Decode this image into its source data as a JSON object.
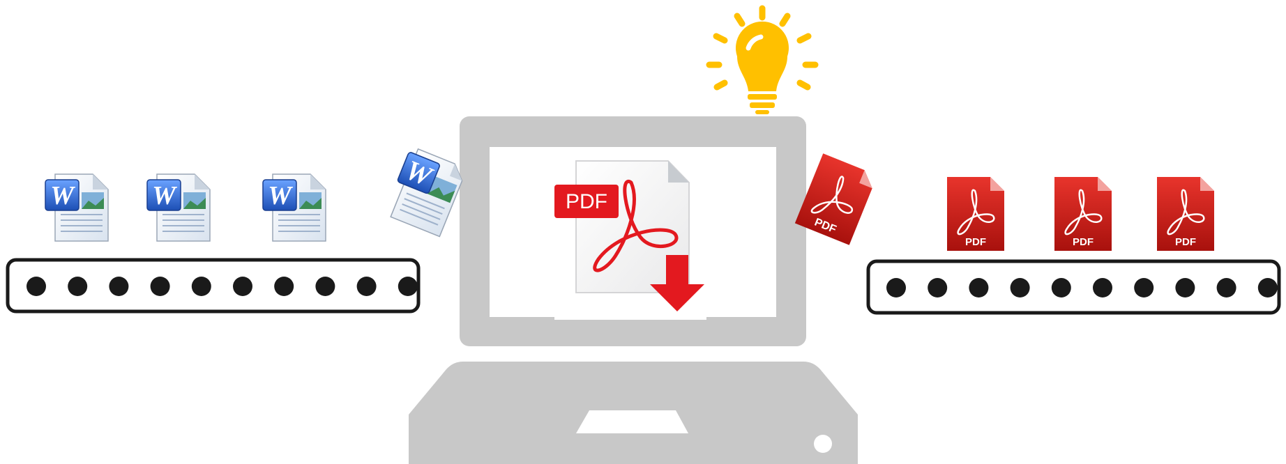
{
  "diagram": {
    "colors": {
      "laptop_gray": "#c8c8c8",
      "screen_white": "#ffffff",
      "belt_outline": "#1a1a1a",
      "belt_dot": "#1a1a1a",
      "word_blue": "#2b64c8",
      "pdf_red": "#d9201c",
      "bulb_yellow": "#ffc000"
    },
    "input_belt": {
      "label": "",
      "documents": [
        {
          "type": "word",
          "icon": "word-document-icon",
          "letter": "W"
        },
        {
          "type": "word",
          "icon": "word-document-icon",
          "letter": "W"
        },
        {
          "type": "word",
          "icon": "word-document-icon",
          "letter": "W"
        }
      ],
      "roller_count": 10
    },
    "incoming_document": {
      "type": "word",
      "icon": "word-document-icon",
      "letter": "W"
    },
    "laptop": {
      "icon": "laptop-icon",
      "screen_icon": "pdf-download-icon",
      "screen_badge": "PDF"
    },
    "idea": {
      "icon": "lightbulb-icon"
    },
    "outgoing_document": {
      "type": "pdf",
      "icon": "pdf-document-icon",
      "label": "PDF"
    },
    "output_belt": {
      "label": "",
      "documents": [
        {
          "type": "pdf",
          "icon": "pdf-document-icon",
          "label": "PDF"
        },
        {
          "type": "pdf",
          "icon": "pdf-document-icon",
          "label": "PDF"
        },
        {
          "type": "pdf",
          "icon": "pdf-document-icon",
          "label": "PDF"
        }
      ],
      "roller_count": 10
    }
  }
}
